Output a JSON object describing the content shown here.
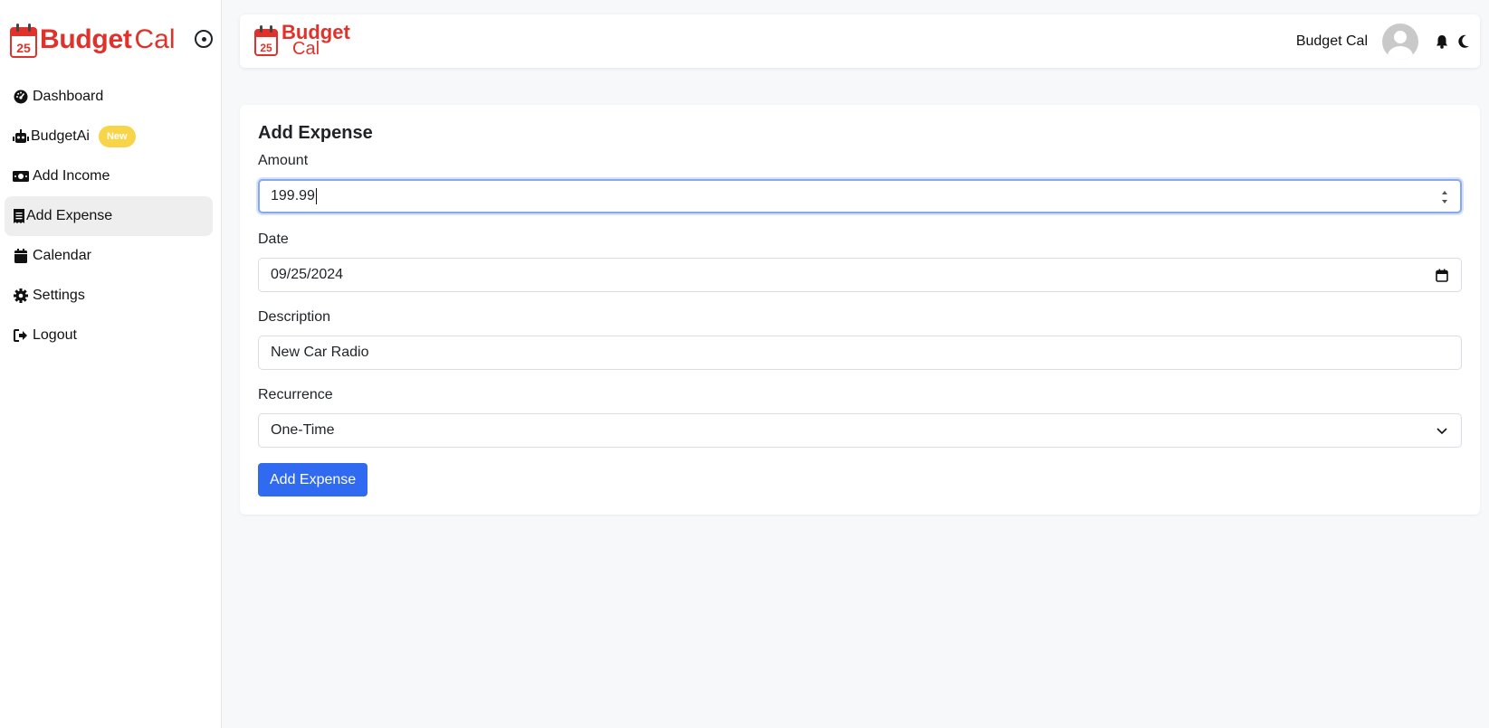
{
  "sidebar": {
    "brand": {
      "bold": "Budget",
      "light": "Cal"
    },
    "items": [
      {
        "label": "Dashboard",
        "icon": "dashboard-icon"
      },
      {
        "label": "BudgetAi",
        "icon": "robot-icon",
        "badge": "New"
      },
      {
        "label": "Add Income",
        "icon": "money-icon"
      },
      {
        "label": "Add Expense",
        "icon": "receipt-icon",
        "active": true
      },
      {
        "label": "Calendar",
        "icon": "calendar-icon"
      },
      {
        "label": "Settings",
        "icon": "gear-icon"
      },
      {
        "label": "Logout",
        "icon": "logout-icon"
      }
    ]
  },
  "header": {
    "brand": {
      "line1": "Budget",
      "line2": "Cal"
    },
    "user_name": "Budget Cal"
  },
  "form": {
    "title": "Add Expense",
    "amount_label": "Amount",
    "amount_value": "199.99",
    "date_label": "Date",
    "date_value": "09/25/2024",
    "description_label": "Description",
    "description_value": "New Car Radio",
    "recurrence_label": "Recurrence",
    "recurrence_value": "One-Time",
    "submit_label": "Add Expense"
  },
  "colors": {
    "brand_red": "#e0322b",
    "primary_blue": "#2f6af0",
    "badge_yellow": "#f8d548",
    "active_item_bg": "#eeeeef"
  }
}
